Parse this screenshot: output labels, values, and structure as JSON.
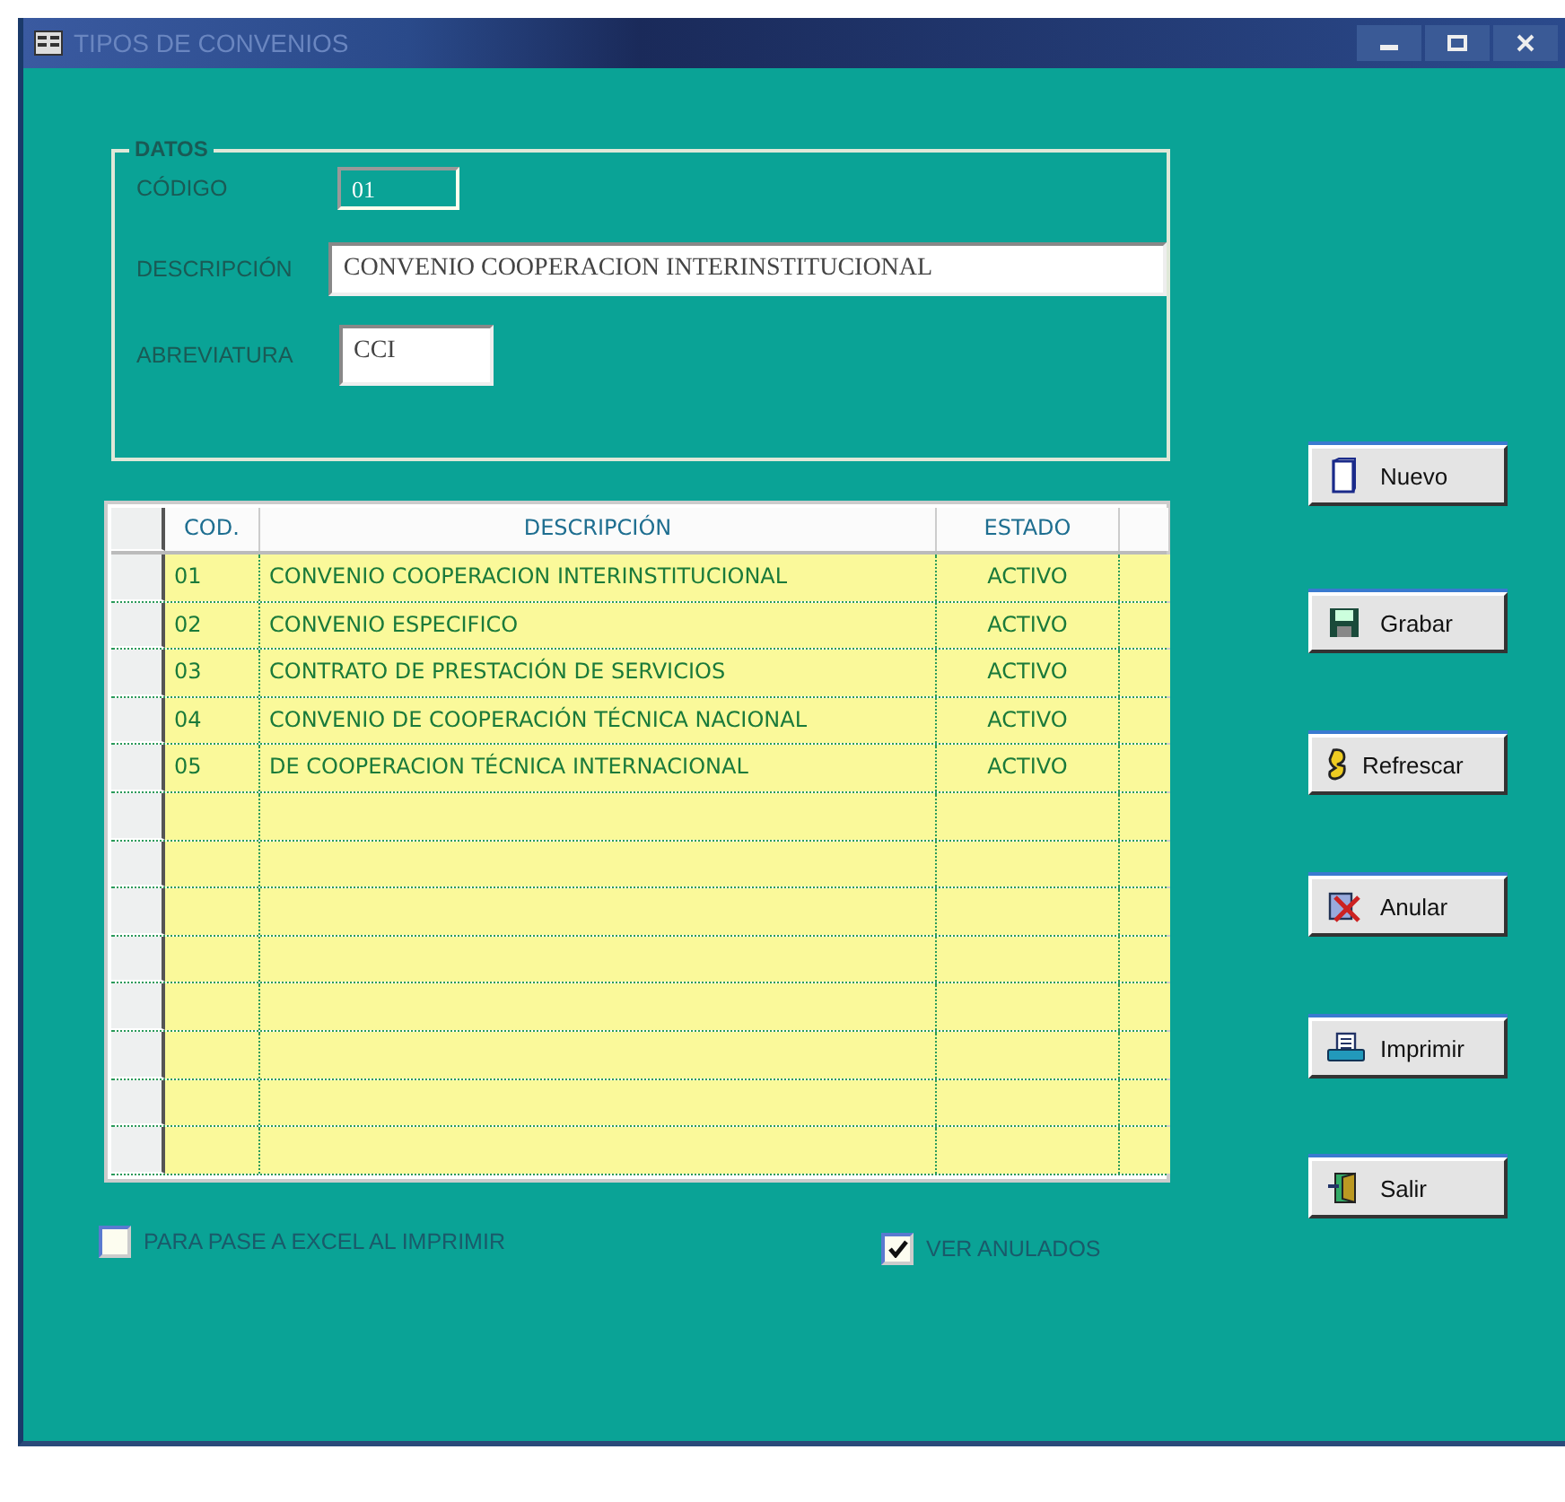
{
  "window": {
    "title": "TIPOS DE CONVENIOS"
  },
  "datos": {
    "legend": "DATOS",
    "fields": [
      {
        "label": "CÓDIGO",
        "value": "01",
        "kind": "short"
      },
      {
        "label": "DESCRIPCIÓN",
        "value": "CONVENIO COOPERACION INTERINSTITUCIONAL",
        "kind": "long"
      },
      {
        "label": "ABREVIATURA",
        "value": "CCI",
        "kind": "medium"
      }
    ]
  },
  "table": {
    "columns": [
      "COD.",
      "DESCRIPCIÓN",
      "ESTADO"
    ],
    "rows": [
      {
        "cod": "01",
        "descripcion": "CONVENIO COOPERACION INTERINSTITUCIONAL",
        "estado": "ACTIVO"
      },
      {
        "cod": "02",
        "descripcion": "CONVENIO ESPECIFICO",
        "estado": "ACTIVO"
      },
      {
        "cod": "03",
        "descripcion": "CONTRATO DE PRESTACIÓN DE SERVICIOS",
        "estado": "ACTIVO"
      },
      {
        "cod": "04",
        "descripcion": "CONVENIO DE COOPERACIÓN TÉCNICA NACIONAL",
        "estado": "ACTIVO"
      },
      {
        "cod": "05",
        "descripcion": "DE COOPERACION TÉCNICA INTERNACIONAL",
        "estado": "ACTIVO"
      }
    ]
  },
  "buttons": [
    {
      "label": "Nuevo",
      "kind": "new"
    },
    {
      "label": "Grabar",
      "kind": "save"
    },
    {
      "label": "Refrescar",
      "kind": "refresh"
    },
    {
      "label": "Anular",
      "kind": "cancel"
    },
    {
      "label": "Imprimir",
      "kind": "print"
    },
    {
      "label": "Salir",
      "kind": "exit"
    }
  ],
  "checkboxes": [
    {
      "label": "PARA PASE A EXCEL AL IMPRIMIR",
      "checked": false
    },
    {
      "label": "VER ANULADOS",
      "checked": true
    }
  ]
}
